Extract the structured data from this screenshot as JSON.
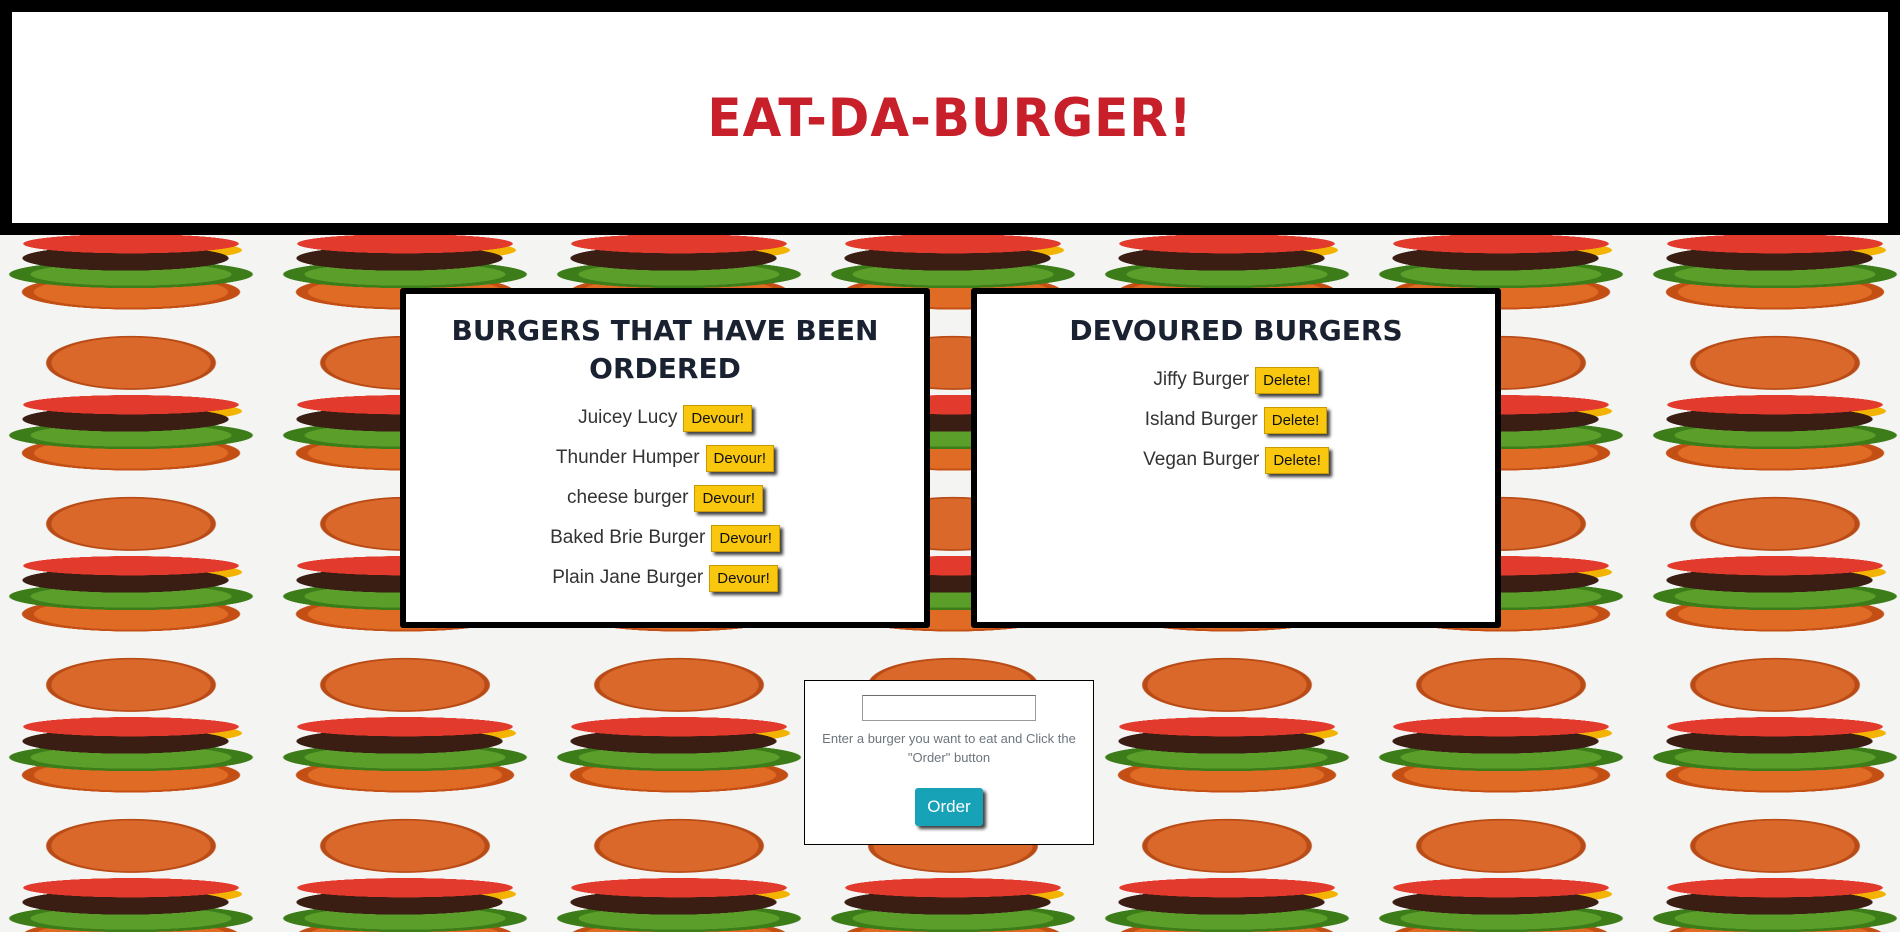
{
  "header": {
    "title": "Eat-Da-Burger!",
    "title_color": "#c7202a"
  },
  "ordered": {
    "title": "Burgers that have been ordered",
    "items": [
      {
        "name": "Juicey Lucy",
        "button": "Devour!"
      },
      {
        "name": "Thunder Humper",
        "button": "Devour!"
      },
      {
        "name": "cheese burger",
        "button": "Devour!"
      },
      {
        "name": "Baked Brie Burger",
        "button": "Devour!"
      },
      {
        "name": "Plain Jane Burger",
        "button": "Devour!"
      }
    ]
  },
  "devoured": {
    "title": "Devoured Burgers",
    "items": [
      {
        "name": "Jiffy Burger",
        "button": "Delete!"
      },
      {
        "name": "Island Burger",
        "button": "Delete!"
      },
      {
        "name": "Vegan Burger",
        "button": "Delete!"
      }
    ]
  },
  "order_form": {
    "input_value": "",
    "help_text": "Enter a burger you want to eat and Click the \"Order\" button",
    "button_label": "Order"
  },
  "colors": {
    "button_yellow": "#f9c70d",
    "order_button": "#17a2b8"
  }
}
